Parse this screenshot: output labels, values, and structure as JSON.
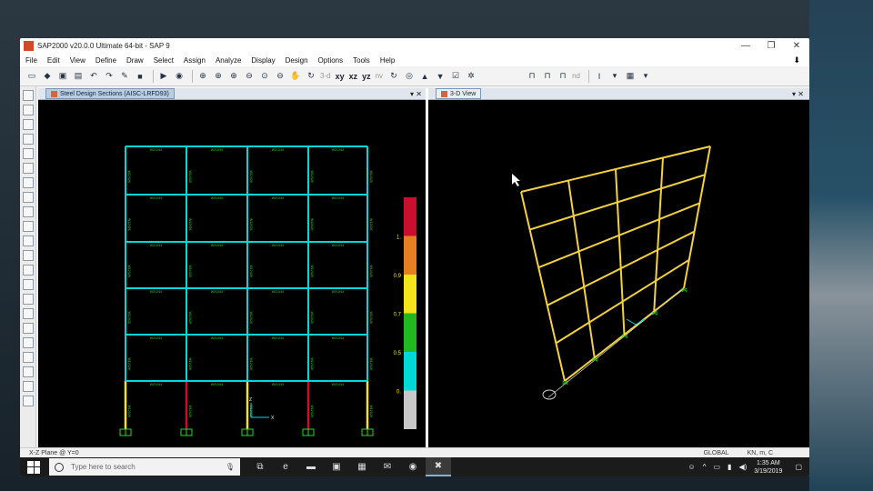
{
  "window": {
    "title": "SAP2000 v20.0.0 Ultimate 64-bit - SAP 9",
    "buttons": [
      "—",
      "❐",
      "✕"
    ]
  },
  "menu": [
    "File",
    "Edit",
    "View",
    "Define",
    "Draw",
    "Select",
    "Assign",
    "Analyze",
    "Display",
    "Design",
    "Options",
    "Tools",
    "Help"
  ],
  "toolbar": {
    "view_labels": [
      "3-d",
      "xy",
      "xz",
      "yz",
      "nv"
    ],
    "nd_label": "nd"
  },
  "left_window": {
    "tab": "Steel Design Sections (AISC-LRFD93)",
    "legend_ticks": [
      "1.",
      "0.9",
      "0.7",
      "0.5",
      "0."
    ],
    "legend_colors": [
      "#c8102e",
      "#e67e22",
      "#f4e41c",
      "#22b822",
      "#00d7d7",
      "#c8c8c8"
    ],
    "beam_label": "W21X44",
    "column_label": "W12X26",
    "axis_x": "X",
    "axis_z": "Z"
  },
  "right_window": {
    "tab": "3-D View"
  },
  "status": {
    "left": "X-Z Plane @ Y=0",
    "global": "GLOBAL",
    "units": "KN, m, C"
  },
  "taskbar": {
    "search_placeholder": "Type here to search",
    "time": "1:35 AM",
    "date": "3/19/2019"
  }
}
